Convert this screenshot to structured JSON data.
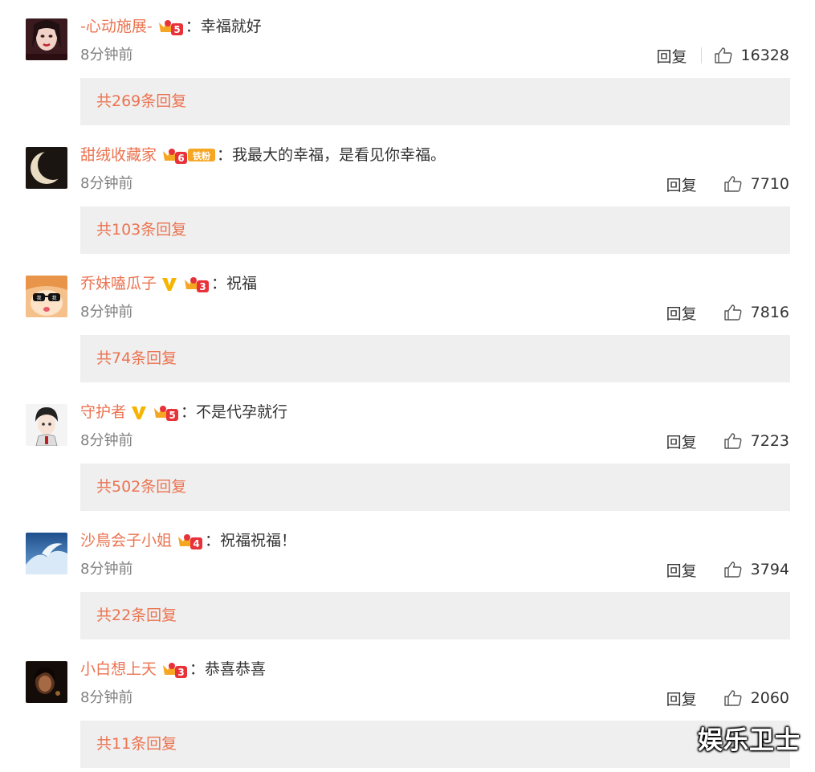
{
  "comments": [
    {
      "username": "-心动施展-",
      "badges": [
        {
          "icon": "crown-level-icon",
          "level": "5"
        }
      ],
      "text": "幸福就好",
      "time": "8分钟前",
      "reply_label": "回复",
      "likes": "16328",
      "replies_label": "共269条回复",
      "avatar": "avatar-woman-dark-makeup"
    },
    {
      "username": "甜绒收藏家",
      "badges": [
        {
          "icon": "crown-level-icon",
          "level": "6"
        },
        {
          "icon": "iron-fan-icon",
          "label": "铁粉"
        }
      ],
      "text": "我最大的幸福，是看见你幸福。",
      "time": "8分钟前",
      "reply_label": "回复",
      "likes": "7710",
      "replies_label": "共103条回复",
      "avatar": "avatar-moon-eclipse"
    },
    {
      "username": "乔妹嗑瓜子",
      "badges": [
        {
          "icon": "verified-v-icon"
        },
        {
          "icon": "crown-level-icon",
          "level": "3"
        }
      ],
      "text": "祝福",
      "time": "8分钟前",
      "reply_label": "回复",
      "likes": "7816",
      "replies_label": "共74条回复",
      "avatar": "avatar-cartoon-sunglasses"
    },
    {
      "username": "守护者",
      "badges": [
        {
          "icon": "verified-v-icon"
        },
        {
          "icon": "crown-level-icon",
          "level": "5"
        }
      ],
      "text": "不是代孕就行",
      "time": "8分钟前",
      "reply_label": "回复",
      "likes": "7223",
      "replies_label": "共502条回复",
      "avatar": "avatar-anime-boy"
    },
    {
      "username": "沙鳥会子小姐",
      "badges": [
        {
          "icon": "crown-level-icon",
          "level": "4"
        }
      ],
      "text": "祝福祝福！",
      "time": "8分钟前",
      "reply_label": "回复",
      "likes": "3794",
      "replies_label": "共22条回复",
      "avatar": "avatar-blue-sky"
    },
    {
      "username": "小白想上天",
      "badges": [
        {
          "icon": "crown-level-icon",
          "level": "3"
        }
      ],
      "text": "恭喜恭喜",
      "time": "8分钟前",
      "reply_label": "回复",
      "likes": "2060",
      "replies_label": "共11条回复",
      "avatar": "avatar-dark-portrait"
    }
  ],
  "watermark": "娱乐卫士",
  "colors": {
    "username": "#eb7350",
    "replies_bg": "#efefef",
    "time": "#808080",
    "crown_red": "#e8323a",
    "crown_gold": "#f5a623"
  }
}
